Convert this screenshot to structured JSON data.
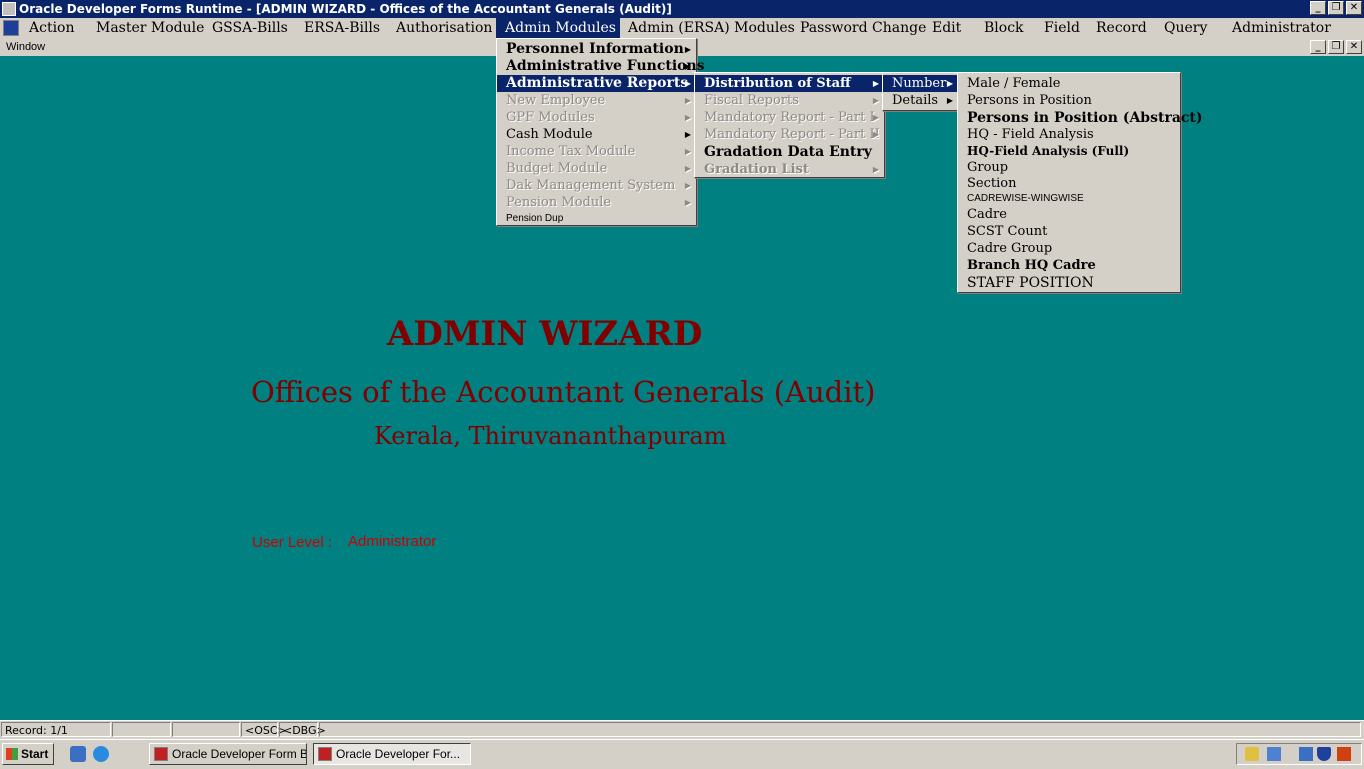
{
  "window": {
    "title": "Oracle Developer Forms Runtime - [ADMIN WIZARD - Offices of the Accountant Generals (Audit)]"
  },
  "menubar": {
    "items": [
      "Action",
      "Master Module",
      "GSSA-Bills",
      "ERSA-Bills",
      "Authorisation",
      "Admin Modules",
      "Admin (ERSA) Modules",
      "Password Change",
      "Edit",
      "Block",
      "Field",
      "Record",
      "Query",
      "Administrator"
    ],
    "active": "Admin Modules",
    "window_menu": "Window"
  },
  "admin_menu": {
    "items": [
      {
        "label": "Personnel Information",
        "enabled": true,
        "submenu": true
      },
      {
        "label": "Administrative Functions",
        "enabled": true,
        "submenu": true
      },
      {
        "label": "Administrative Reports",
        "enabled": true,
        "submenu": true,
        "selected": true
      },
      {
        "label": "New Employee",
        "enabled": false,
        "submenu": true
      },
      {
        "label": "GPF Modules",
        "enabled": false,
        "submenu": true
      },
      {
        "label": "Cash Module",
        "enabled": true,
        "submenu": true
      },
      {
        "label": "Income Tax Module",
        "enabled": false,
        "submenu": true
      },
      {
        "label": "Budget Module",
        "enabled": false,
        "submenu": true
      },
      {
        "label": "Dak Management System",
        "enabled": false,
        "submenu": true
      },
      {
        "label": "Pension Module",
        "enabled": false,
        "submenu": true
      },
      {
        "label": "Pension Dup",
        "enabled": true,
        "submenu": false
      }
    ]
  },
  "reports_menu": {
    "items": [
      {
        "label": "Distribution of Staff",
        "enabled": true,
        "submenu": true,
        "selected": true
      },
      {
        "label": "Fiscal Reports",
        "enabled": false,
        "submenu": true
      },
      {
        "label": "Mandatory Report - Part I",
        "enabled": false,
        "submenu": true
      },
      {
        "label": "Mandatory Report - Part II",
        "enabled": false,
        "submenu": true
      },
      {
        "label": "Gradation Data Entry",
        "enabled": true,
        "submenu": false
      },
      {
        "label": "Gradation List",
        "enabled": false,
        "submenu": true
      }
    ]
  },
  "distribution_menu": {
    "items": [
      {
        "label": "Number",
        "enabled": true,
        "submenu": true,
        "selected": true
      },
      {
        "label": "Details",
        "enabled": true,
        "submenu": true
      }
    ]
  },
  "number_menu": {
    "items": [
      "Male / Female",
      "Persons in Position",
      "Persons in Position (Abstract)",
      "HQ - Field Analysis",
      "HQ-Field Analysis (Full)",
      "Group",
      "Section",
      "CADREWISE-WINGWISE",
      "Cadre",
      "SCST Count",
      "Cadre Group",
      "Branch HQ Cadre",
      "STAFF POSITION"
    ]
  },
  "content": {
    "heading": "ADMIN WIZARD",
    "subtitle": "Offices of the Accountant Generals (Audit)",
    "location": "Kerala, Thiruvananthapuram",
    "user_level_label": "User Level :",
    "user_level_value": "Administrator"
  },
  "statusbar": {
    "record": "Record: 1/1",
    "osc": "<OSC>",
    "dbg": "<DBG>"
  },
  "taskbar": {
    "start": "Start",
    "tasks": [
      "Oracle Developer Form B...",
      "Oracle Developer For..."
    ]
  },
  "colors": {
    "desktop": "#008080",
    "titlebar": "#0a246a",
    "menu_face": "#d4d0c8",
    "heading": "#800000",
    "user_level": "#cc0000"
  }
}
